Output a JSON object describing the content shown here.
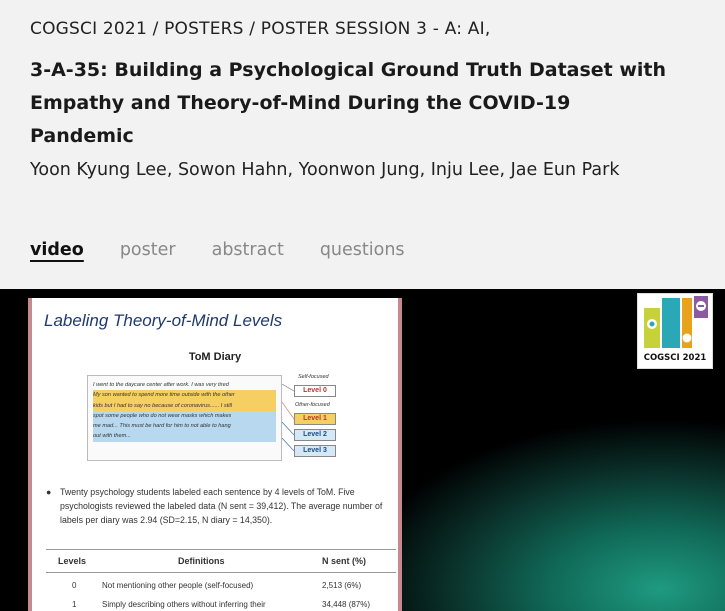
{
  "breadcrumb": "COGSCI 2021 / POSTERS / POSTER SESSION 3 - A: AI,",
  "poster": {
    "title": "3-A-35: Building a Psychological Ground Truth Dataset with Empathy and Theory-of-Mind During the COVID-19 Pandemic",
    "authors": "Yoon Kyung Lee, Sowon Hahn, Yoonwon Jung, Inju Lee, Jae Eun Park"
  },
  "tabs": [
    {
      "label": "video",
      "active": true
    },
    {
      "label": "poster",
      "active": false
    },
    {
      "label": "abstract",
      "active": false
    },
    {
      "label": "questions",
      "active": false
    }
  ],
  "slide": {
    "title": "Labeling Theory-of-Mind Levels",
    "diary_title": "ToM Diary",
    "diary_lines": [
      "I went to the daycare center after work. I was very tired",
      "My son wanted to spend more time outside with the other",
      "kids but I had to say no because of coronavirus...... I still",
      "spot some people who do not wear masks which makes",
      "me mad... This must be hard for him to not able to hang",
      "out with them..."
    ],
    "self_focused_label": "Self-focused",
    "other_focused_label": "Other-focused",
    "levels": [
      "Level 0",
      "Level 1",
      "Level 2",
      "Level 3"
    ],
    "bullet": "Twenty psychology students labeled each sentence by 4 levels of ToM. Five psychologists reviewed the labeled data (N sent = 39,412). The average number of labels per diary was 2.94 (SD=2.15, N diary = 14,350).",
    "table": {
      "headers": [
        "Levels",
        "Definitions",
        "N sent (%)"
      ],
      "rows": [
        [
          "0",
          "Not mentioning other people (self-focused)",
          "2,513 (6%)"
        ],
        [
          "1",
          "Simply describing others without inferring their",
          "34,448 (87%)"
        ]
      ]
    }
  },
  "logo": {
    "text": "COGSCI 2021",
    "colors": [
      "#c7d23a",
      "#2ba8b5",
      "#e8a21c",
      "#8c5aa0"
    ]
  }
}
